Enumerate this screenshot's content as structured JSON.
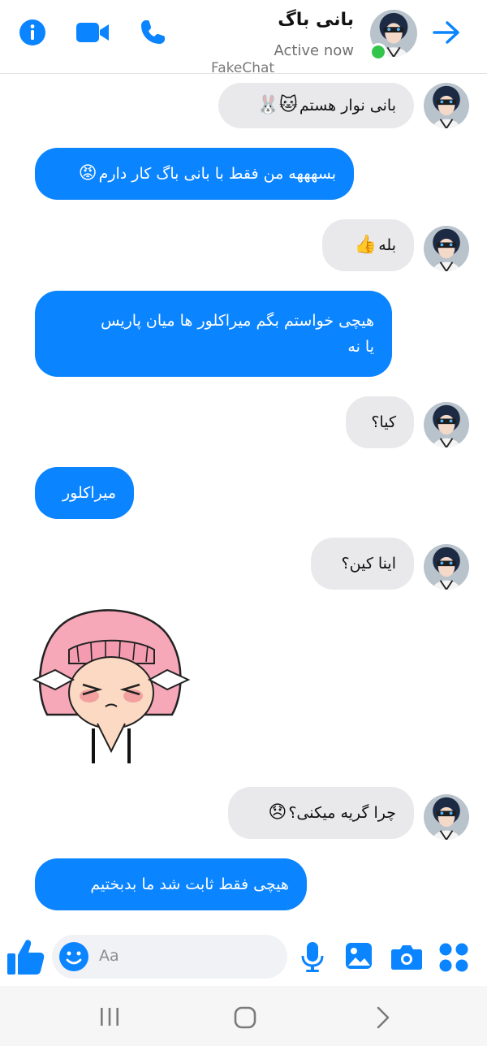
{
  "header": {
    "contact_name": "بانی باگ",
    "status": "Active now",
    "watermark": "FakeChat"
  },
  "messages": [
    {
      "direction": "incoming",
      "text": "بانی نوار هستم",
      "emoji": "🐱🐰"
    },
    {
      "direction": "outgoing",
      "text": "بسهههه من فقط با بانی باگ کار دارم",
      "emoji": "😡"
    },
    {
      "direction": "incoming",
      "text": "بله",
      "emoji": "👍"
    },
    {
      "direction": "outgoing",
      "text_line1": "هیچی خواستم بگم میراکلور ها میان پاریس",
      "text_line2": "یا نه"
    },
    {
      "direction": "incoming",
      "text": "کیا؟"
    },
    {
      "direction": "outgoing",
      "text": "میراکلور"
    },
    {
      "direction": "incoming",
      "text": "اینا کین؟"
    },
    {
      "direction": "outgoing",
      "type": "sticker",
      "sticker": "crying-girl-sticker"
    },
    {
      "direction": "incoming",
      "text": "چرا گریه میکنی؟",
      "emoji": "😞"
    },
    {
      "direction": "outgoing",
      "text": "هیچی فقط ثابت شد ما بدبختیم"
    }
  ],
  "composer": {
    "placeholder": "Aa"
  },
  "icons": {
    "info": "info-icon",
    "video": "video-camera-icon",
    "phone": "phone-icon",
    "back": "arrow-right-icon",
    "like": "thumbs-up-icon",
    "emoji": "smiley-icon",
    "mic": "microphone-icon",
    "gallery": "image-icon",
    "camera": "camera-icon",
    "more": "apps-icon"
  },
  "nav": [
    "recent-apps-icon",
    "home-icon",
    "back-nav-icon"
  ],
  "colors": {
    "accent": "#0a84ff",
    "incoming_bubble": "#e9e9eb",
    "online": "#31c64b"
  }
}
